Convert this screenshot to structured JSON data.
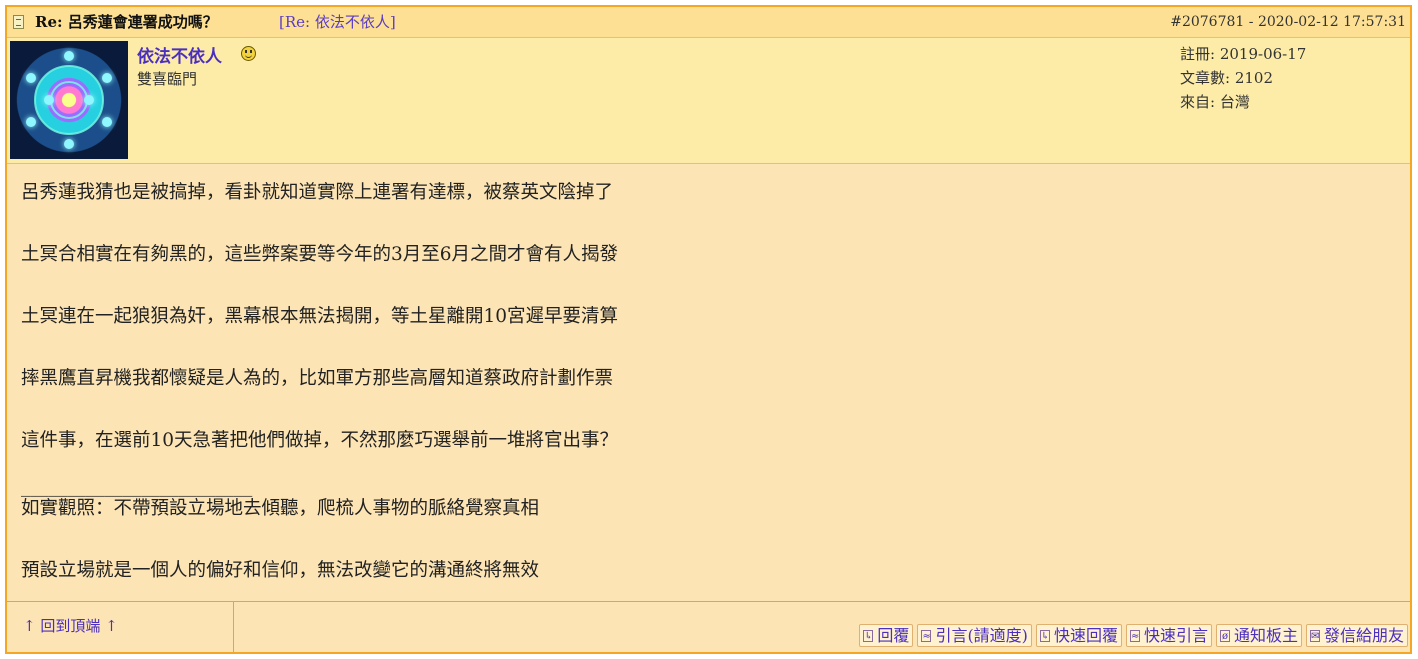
{
  "header": {
    "subject": "Re: 呂秀蓮會連署成功嗎？",
    "reply_to": "[Re: 依法不依人]",
    "post_id": "#2076781",
    "datetime": "- 2020-02-12 17:57:31"
  },
  "author": {
    "name": "依法不依人",
    "title": "雙喜臨門",
    "registered": "註冊: 2019-06-17",
    "posts": "文章數: 2102",
    "location": "來自: 台灣"
  },
  "body": {
    "lines": [
      "呂秀蓮我猜也是被搞掉，看卦就知道實際上連署有達標，被蔡英文陰掉了",
      "土冥合相實在有夠黑的，這些弊案要等今年的3月至6月之間才會有人揭發",
      "土冥連在一起狼狽為奸，黑幕根本無法揭開，等土星離開10宮遲早要清算",
      "摔黑鷹直昇機我都懷疑是人為的，比如軍方那些高層知道蔡政府計劃作票",
      "這件事，在選前10天急著把他們做掉，不然那麼巧選舉前一堆將官出事？"
    ],
    "signature_separator": "_________________________",
    "signature": [
      "如實觀照：不帶預設立場地去傾聽，爬梳人事物的脈絡覺察真相",
      "預設立場就是一個人的偏好和信仰，無法改變它的溝通終將無效"
    ]
  },
  "footer": {
    "back_to_top": "↑ 回到頂端 ↑",
    "actions": [
      {
        "icon": "reply-icon",
        "label": "回覆"
      },
      {
        "icon": "quote-icon",
        "label": "引言(請適度)"
      },
      {
        "icon": "quick-reply-icon",
        "label": "快速回覆"
      },
      {
        "icon": "quick-quote-icon",
        "label": "快速引言"
      },
      {
        "icon": "notify-icon",
        "label": "通知板主"
      },
      {
        "icon": "mail-icon",
        "label": "發信給朋友"
      }
    ]
  }
}
